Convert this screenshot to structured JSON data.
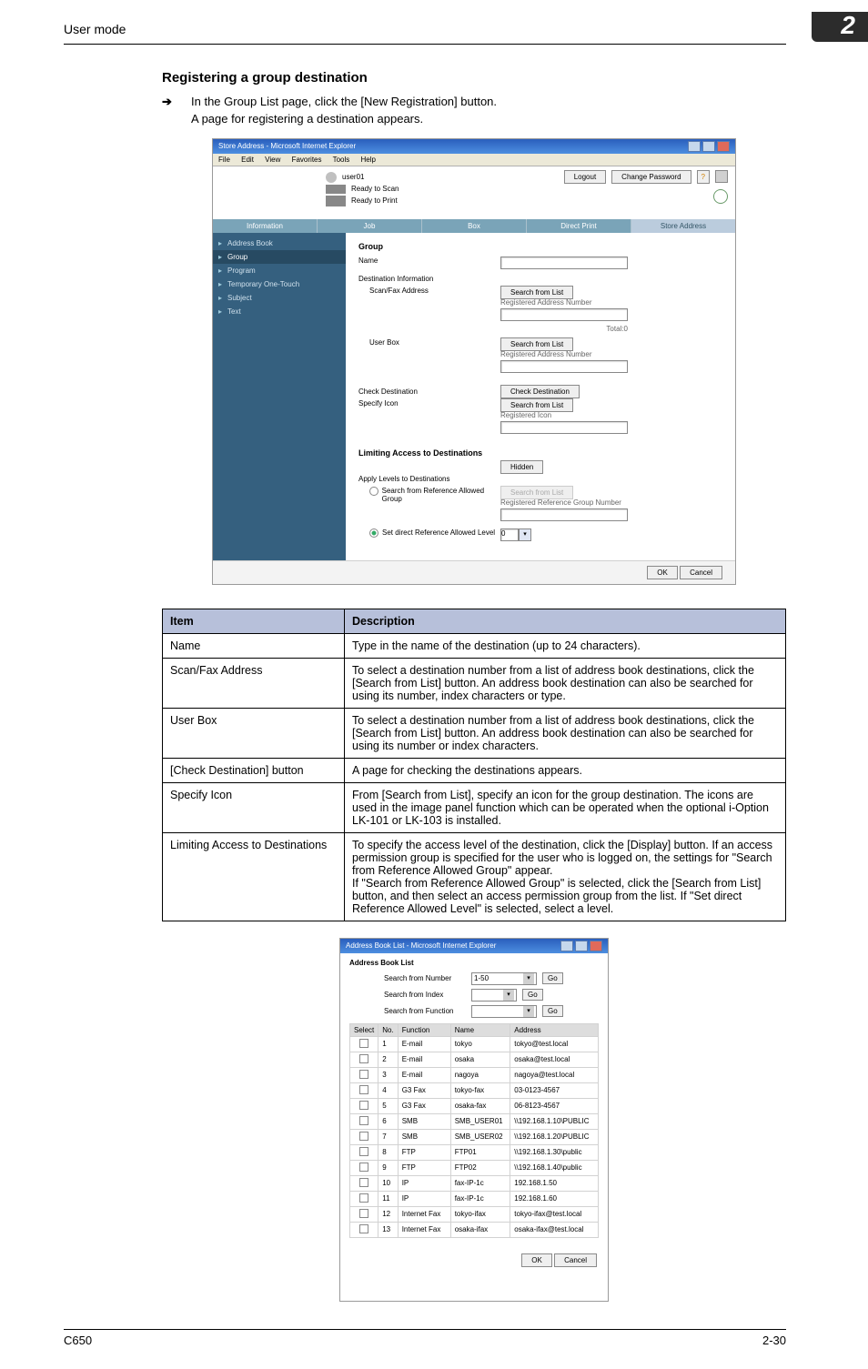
{
  "page": {
    "header": "User mode",
    "chapter": "2",
    "model": "C650",
    "page_num": "2-30"
  },
  "section": {
    "title": "Registering a group destination",
    "step": "In the Group List page, click the [New Registration] button.",
    "sub": "A page for registering a destination appears."
  },
  "screenshot1": {
    "window_title": "Store Address - Microsoft Internet Explorer",
    "menu": {
      "file": "File",
      "edit": "Edit",
      "view": "View",
      "favorites": "Favorites",
      "tools": "Tools",
      "help": "Help"
    },
    "user": "user01",
    "status": {
      "scan": "Ready to Scan",
      "print": "Ready to Print"
    },
    "btn_logout": "Logout",
    "btn_change_pw": "Change Password",
    "tabs": {
      "info": "Information",
      "job": "Job",
      "box": "Box",
      "direct": "Direct Print",
      "store": "Store Address"
    },
    "sidebar": {
      "addr": "Address Book",
      "group": "Group",
      "program": "Program",
      "temp": "Temporary One-Touch",
      "subject": "Subject",
      "text": "Text"
    },
    "group_h": "Group",
    "labels": {
      "name": "Name",
      "dest_info": "Destination Information",
      "scanfax": "Scan/Fax Address",
      "userbox": "User Box",
      "checkdest": "Check Destination",
      "specicon": "Specify Icon",
      "limiting": "Limiting Access to Destinations",
      "apply": "Apply Levels to Destinations",
      "search_ref": "Search from Reference Allowed Group",
      "set_direct": "Set direct Reference Allowed Level"
    },
    "btn_search": "Search from List",
    "reg_addr_num": "Registered Address Number",
    "total": "Total:0",
    "btn_check_dest": "Check Destination",
    "reg_icon": "Registered Icon",
    "btn_hidden": "Hidden",
    "btn_search_dis": "Search from List",
    "reg_ref_group": "Registered Reference Group Number",
    "dropdown_val": "0",
    "btn_ok": "OK",
    "btn_cancel": "Cancel"
  },
  "desc_table": {
    "h_item": "Item",
    "h_desc": "Description",
    "rows": [
      {
        "item": "Name",
        "desc": "Type in the name of the destination (up to 24 characters)."
      },
      {
        "item": "Scan/Fax Address",
        "desc": "To select a destination number from a list of address book destinations, click the [Search from List] button. An address book destination can also be searched for using its number, index characters or type."
      },
      {
        "item": "User Box",
        "desc": "To select a destination number from a list of address book destinations, click the [Search from List] button. An address book destination can also be searched for using its number or index characters."
      },
      {
        "item": "[Check Destination] button",
        "desc": "A page for checking the destinations appears."
      },
      {
        "item": "Specify Icon",
        "desc": "From [Search from List], specify an icon for the group destination. The icons are used in the image panel function which can be operated when the optional i-Option LK-101 or LK-103 is installed."
      },
      {
        "item": "Limiting Access to Destinations",
        "desc": "To specify the access level of the destination, click the [Display] button. If an access permission group is specified for the user who is logged on, the settings for \"Search from Reference Allowed Group\" appear.\nIf \"Search from Reference Allowed Group\" is selected, click the [Search from List] button, and then select an access permission group from the list. If \"Set direct Reference Allowed Level\" is selected, select a level."
      }
    ]
  },
  "screenshot2": {
    "window_title": "Address Book List - Microsoft Internet Explorer",
    "heading": "Address Book List",
    "labels": {
      "num": "Search from Number",
      "index": "Search from Index",
      "func": "Search from Function"
    },
    "range": "1-50",
    "go": "Go",
    "headers": {
      "select": "Select",
      "no": "No.",
      "function": "Function",
      "name": "Name",
      "address": "Address"
    },
    "rows": [
      {
        "no": "1",
        "fn": "E-mail",
        "name": "tokyo",
        "addr": "tokyo@test.local"
      },
      {
        "no": "2",
        "fn": "E-mail",
        "name": "osaka",
        "addr": "osaka@test.local"
      },
      {
        "no": "3",
        "fn": "E-mail",
        "name": "nagoya",
        "addr": "nagoya@test.local"
      },
      {
        "no": "4",
        "fn": "G3 Fax",
        "name": "tokyo-fax",
        "addr": "03-0123-4567"
      },
      {
        "no": "5",
        "fn": "G3 Fax",
        "name": "osaka-fax",
        "addr": "06-8123-4567"
      },
      {
        "no": "6",
        "fn": "SMB",
        "name": "SMB_USER01",
        "addr": "\\\\192.168.1.10\\PUBLIC"
      },
      {
        "no": "7",
        "fn": "SMB",
        "name": "SMB_USER02",
        "addr": "\\\\192.168.1.20\\PUBLIC"
      },
      {
        "no": "8",
        "fn": "FTP",
        "name": "FTP01",
        "addr": "\\\\192.168.1.30\\public"
      },
      {
        "no": "9",
        "fn": "FTP",
        "name": "FTP02",
        "addr": "\\\\192.168.1.40\\public"
      },
      {
        "no": "10",
        "fn": "IP",
        "name": "fax-IP-1c",
        "addr": "192.168.1.50"
      },
      {
        "no": "11",
        "fn": "IP",
        "name": "fax-IP-1c",
        "addr": "192.168.1.60"
      },
      {
        "no": "12",
        "fn": "Internet Fax",
        "name": "tokyo-ifax",
        "addr": "tokyo-ifax@test.local"
      },
      {
        "no": "13",
        "fn": "Internet Fax",
        "name": "osaka-ifax",
        "addr": "osaka-ifax@test.local"
      }
    ],
    "btn_ok": "OK",
    "btn_cancel": "Cancel"
  }
}
